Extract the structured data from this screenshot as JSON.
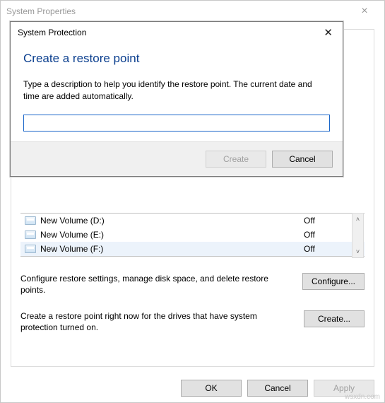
{
  "parent_window": {
    "title": "System Properties",
    "close_glyph": "×",
    "buttons": {
      "ok": "OK",
      "cancel": "Cancel",
      "apply": "Apply"
    }
  },
  "drives": [
    {
      "name": "New Volume (D:)",
      "status": "Off"
    },
    {
      "name": "New Volume (E:)",
      "status": "Off"
    },
    {
      "name": "New Volume (F:)",
      "status": "Off"
    }
  ],
  "scroll": {
    "up": "˄",
    "down": "˅"
  },
  "config_section": {
    "text": "Configure restore settings, manage disk space, and delete restore points.",
    "button": "Configure..."
  },
  "create_section": {
    "text": "Create a restore point right now for the drives that have system protection turned on.",
    "button": "Create..."
  },
  "modal": {
    "title": "System Protection",
    "close_glyph": "✕",
    "heading": "Create a restore point",
    "description": "Type a description to help you identify the restore point. The current date and time are added automatically.",
    "input_value": "",
    "buttons": {
      "create": "Create",
      "cancel": "Cancel"
    }
  },
  "watermark": "wsxdn.com"
}
